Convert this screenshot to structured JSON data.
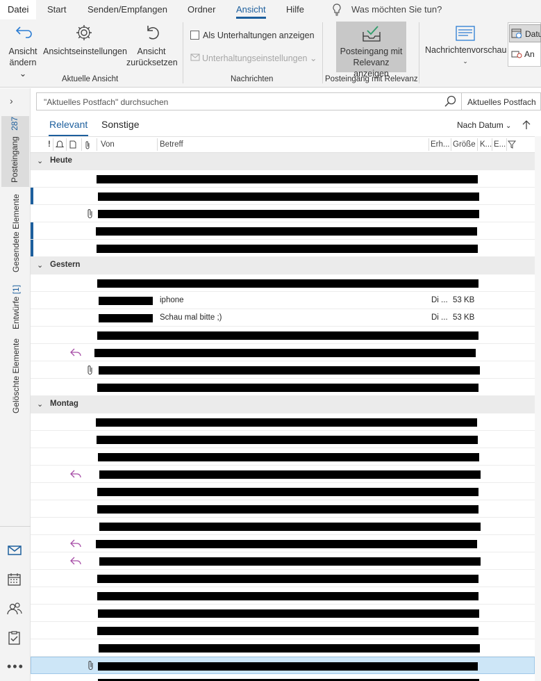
{
  "menu": {
    "file": "Datei",
    "items": [
      "Start",
      "Senden/Empfangen",
      "Ordner",
      "Ansicht",
      "Hilfe"
    ],
    "tell_me": "Was möchten Sie tun?"
  },
  "ribbon": {
    "change_view_line1": "Ansicht",
    "change_view_line2": "ändern ⌄",
    "view_settings": "Ansichtseinstellungen",
    "reset_view_line1": "Ansicht",
    "reset_view_line2": "zurücksetzen",
    "group_current_view": "Aktuelle Ansicht",
    "show_conversations": "Als Unterhaltungen anzeigen",
    "conversation_settings": "Unterhaltungseinstellungen ⌄",
    "group_messages": "Nachrichten",
    "focused_line1": "Posteingang mit",
    "focused_line2": "Relevanz anzeigen",
    "group_focused": "Posteingang mit Relevanz",
    "message_preview": "Nachrichtenvorschau",
    "date_label": "Datu",
    "to_label": "An"
  },
  "leftnav": {
    "inbox_label": "Posteingang",
    "inbox_count": "287",
    "sent": "Gesendete Elemente",
    "drafts_label": "Entwürfe",
    "drafts_count": "[1]",
    "deleted": "Gelöschte Elemente"
  },
  "search": {
    "placeholder": "\"Aktuelles Postfach\" durchsuchen",
    "scope": "Aktuelles Postfach"
  },
  "tabs": {
    "focused": "Relevant",
    "other": "Sonstige",
    "sort": "Nach Datum"
  },
  "columns": {
    "importance": "!",
    "from": "Von",
    "subject": "Betreff",
    "received": "Erh...",
    "size": "Größe",
    "category": "K...",
    "flag": "E..."
  },
  "groups": {
    "today": "Heute",
    "yesterday": "Gestern",
    "monday": "Montag"
  },
  "visible_rows": [
    {
      "subject": "iphone",
      "received": "Di ...",
      "size": "53 KB"
    },
    {
      "subject": "Schau mal bitte ;)",
      "received": "Di ...",
      "size": "53 KB"
    }
  ],
  "colors": {
    "accent": "#1d5f9d",
    "reply_icon": "#a64ca6",
    "selected_row": "#cde6f7"
  }
}
